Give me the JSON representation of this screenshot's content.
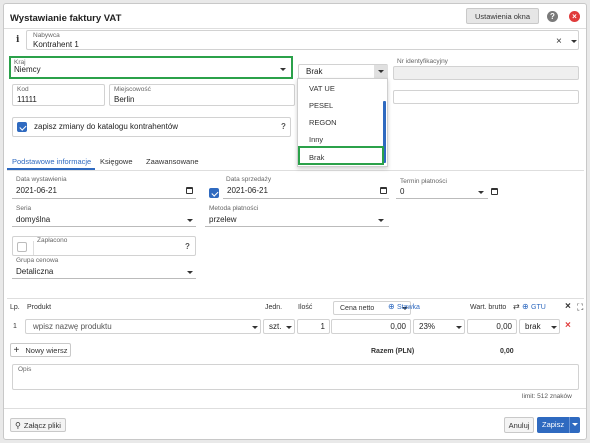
{
  "dialog": {
    "title": "Wystawianie faktury VAT",
    "settings_button": "Ustawienia okna",
    "help_icon": "question-circle-icon",
    "close_icon": "close-circle-icon"
  },
  "buyer": {
    "label": "Nabywca",
    "value": "Kontrahent 1",
    "clear": "×",
    "info_icon": "info-icon"
  },
  "country": {
    "label": "Kraj",
    "value": "Niemcy"
  },
  "id_type": {
    "value": "Brak",
    "id_label": "Nr identyfikacyjny"
  },
  "id_type_options": [
    "VAT UE",
    "PESEL",
    "REGON",
    "Inny",
    "Brak"
  ],
  "postal": {
    "code_label": "Kod",
    "code": "11111",
    "city_label": "Miejscowość",
    "city": "Berlin"
  },
  "save_changes": {
    "label": "zapisz zmiany do katalogu kontrahentów",
    "checked": true,
    "help": "?"
  },
  "tabs": [
    {
      "label": "Podstawowe informacje",
      "active": true
    },
    {
      "label": "Księgowe",
      "active": false
    },
    {
      "label": "Zaawansowane",
      "active": false
    }
  ],
  "basic": {
    "issue_date_label": "Data wystawienia",
    "issue_date": "2021-06-21",
    "sale_date_label": "Data sprzedaży",
    "sale_date": "2021-06-21",
    "payment_term_label": "Termin płatności",
    "payment_term": "0",
    "series_label": "Seria",
    "series": "domyślna",
    "payment_method_label": "Metoda płatności",
    "payment_method": "przelew",
    "paid_label": "Zapłacono",
    "paid_help": "?",
    "price_group_label": "Grupa cenowa",
    "price_group": "Detaliczna"
  },
  "items": {
    "headers": {
      "lp": "Lp.",
      "product": "Produkt",
      "unit": "Jedn.",
      "qty": "Ilość",
      "net_price": "Cena netto",
      "rate": "Stawka",
      "gross": "Wart. brutto",
      "gtu": "GTU"
    },
    "rows": [
      {
        "lp": "1",
        "product_placeholder": "wpisz nazwę produktu",
        "unit": "szt.",
        "qty": "1",
        "net_price": "0,00",
        "rate": "23%",
        "gross": "0,00",
        "gtu": "brak"
      }
    ],
    "new_row_button": "Nowy wiersz",
    "total_label": "Razem (PLN)",
    "total_value": "0,00"
  },
  "notes": {
    "label": "Opis",
    "limit": "limit: 512 znaków"
  },
  "footer": {
    "attach_button": "Załącz pliki",
    "cancel_button": "Anuluj",
    "save_button": "Zapisz"
  },
  "colors": {
    "accent": "#2f6ac0",
    "highlight": "#2ba14a",
    "close": "#e03b3b"
  }
}
